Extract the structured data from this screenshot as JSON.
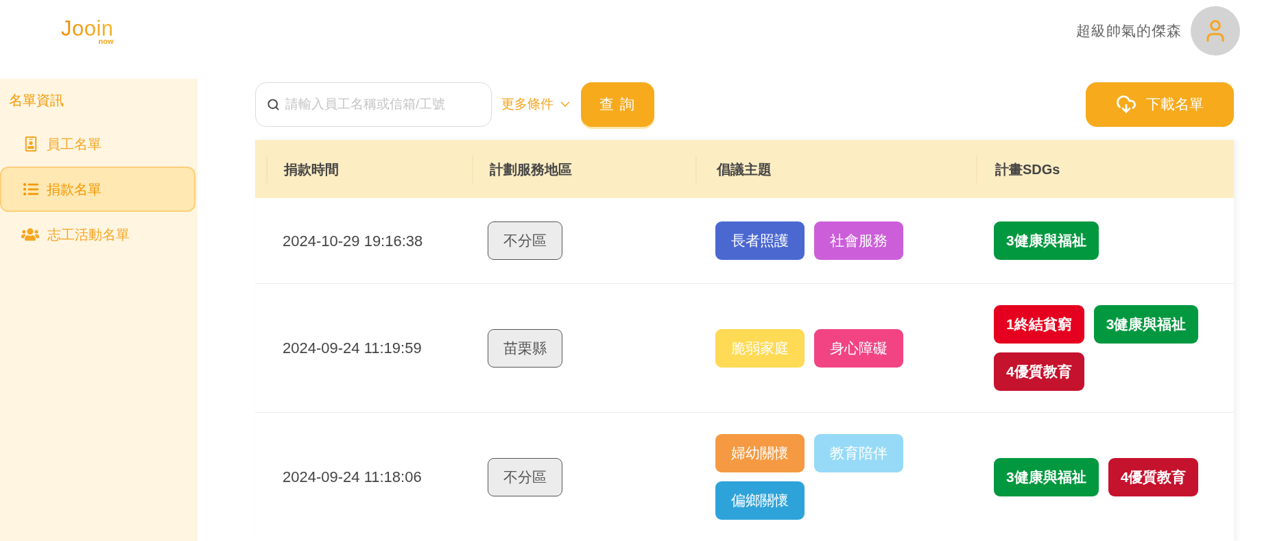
{
  "logo": {
    "wordmark": "Jooin",
    "tagline": "now"
  },
  "user": {
    "name": "超級帥氣的傑森"
  },
  "sidebar": {
    "title": "名單資訊",
    "items": [
      {
        "label": "員工名單",
        "selected": false
      },
      {
        "label": "捐款名單",
        "selected": true
      },
      {
        "label": "志工活動名單",
        "selected": false
      }
    ]
  },
  "toolbar": {
    "search": {
      "placeholder": "請輸入員工名稱或信箱/工號"
    },
    "more_filters": {
      "label": "更多條件",
      "expanded": false
    },
    "query_button": "查 詢",
    "download_button": "下載名單"
  },
  "table": {
    "columns": [
      "捐款時間",
      "計劃服務地區",
      "倡議主題",
      "計畫SDGs"
    ],
    "rows": [
      {
        "time": "2024-10-29 19:16:38",
        "region": "不分區",
        "themes": [
          {
            "label": "長者照護",
            "color": "#4b68d1"
          },
          {
            "label": "社會服務",
            "color": "#cc5ed9"
          }
        ],
        "sdgs": [
          {
            "label": "3健康與福祉",
            "color": "#02983f"
          }
        ]
      },
      {
        "time": "2024-09-24 11:19:59",
        "region": "苗栗縣",
        "themes": [
          {
            "label": "脆弱家庭",
            "color": "#ffda55"
          },
          {
            "label": "身心障礙",
            "color": "#f24483"
          }
        ],
        "sdgs": [
          {
            "label": "1終結貧窮",
            "color": "#e6001f"
          },
          {
            "label": "3健康與福祉",
            "color": "#02983f"
          },
          {
            "label": "4優質教育",
            "color": "#c5122d"
          }
        ]
      },
      {
        "time": "2024-09-24 11:18:06",
        "region": "不分區",
        "themes": [
          {
            "label": "婦幼關懷",
            "color": "#f59a42"
          },
          {
            "label": "教育陪伴",
            "color": "#97daf8"
          },
          {
            "label": "偏鄉關懷",
            "color": "#2ea3d9"
          }
        ],
        "sdgs": [
          {
            "label": "3健康與福祉",
            "color": "#02983f"
          },
          {
            "label": "4優質教育",
            "color": "#c5122d"
          }
        ]
      }
    ]
  }
}
